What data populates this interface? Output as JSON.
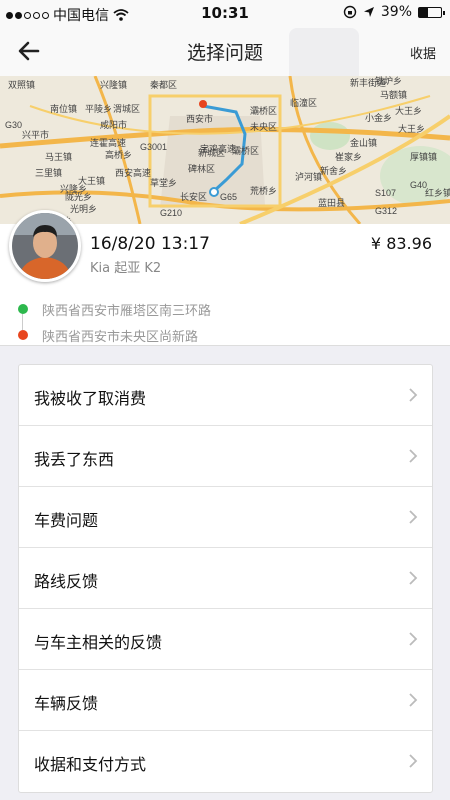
{
  "status_bar": {
    "carrier": "中国电信",
    "time": "10:31",
    "battery": "39%",
    "battery_level": 0.39
  },
  "nav": {
    "title": "选择问题",
    "receipt_label": "收据"
  },
  "map": {
    "labels": [
      "双照镇",
      "兴隆镇",
      "秦都区",
      "渭城区",
      "西安市",
      "临潼区",
      "新丰街道",
      "马额镇",
      "咸阳市",
      "灞桥区",
      "铁炉乡",
      "小金乡",
      "平陵乡",
      "南位镇",
      "兴平市",
      "G3001",
      "未央区",
      "金山镇",
      "宝鸡高速",
      "新城区",
      "连霍高速",
      "高桥乡",
      "灞桥区",
      "大王乡",
      "碑林区",
      "崔家乡",
      "马王镇",
      "大王镇",
      "G30",
      "长安区",
      "G65",
      "蓝田县",
      "厚镇镇",
      "泸河镇",
      "陇光乡",
      "光明乡",
      "G210",
      "G312",
      "G40",
      "S107",
      "三里镇",
      "兴隆乡",
      "荒桥乡",
      "西安高速",
      "草堂乡",
      "广店乡",
      "新舍乡",
      "红乡镇",
      "大王乡"
    ]
  },
  "trip": {
    "datetime": "16/8/20 13:17",
    "car": "Kia 起亚 K2",
    "price": "¥ 83.96",
    "start": "陕西省西安市雁塔区南三环路",
    "end": "陕西省西安市未央区尚新路"
  },
  "issues": [
    {
      "label": "我被收了取消费"
    },
    {
      "label": "我丢了东西"
    },
    {
      "label": "车费问题"
    },
    {
      "label": "路线反馈"
    },
    {
      "label": "与车主相关的反馈"
    },
    {
      "label": "车辆反馈"
    },
    {
      "label": "收据和支付方式"
    }
  ],
  "colors": {
    "accent_start": "#2db84d",
    "accent_end": "#e8451e",
    "route": "#3a9bd5"
  }
}
